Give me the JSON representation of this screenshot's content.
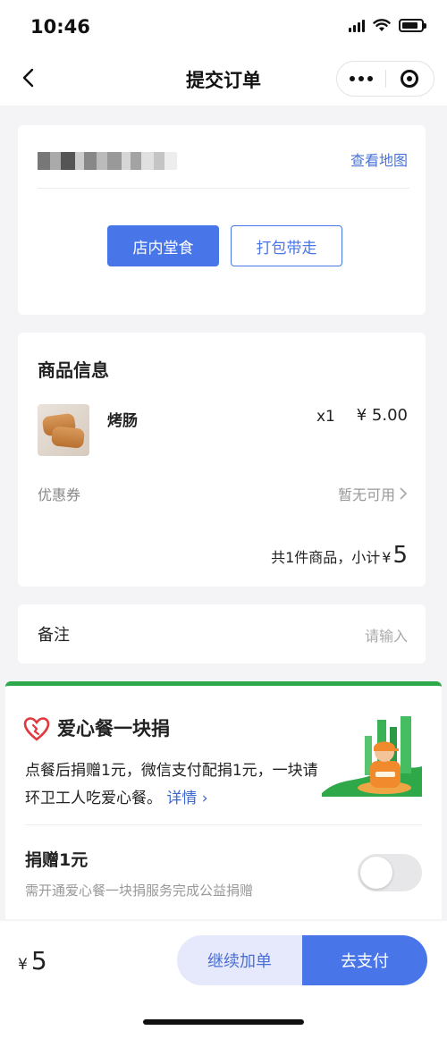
{
  "status_bar": {
    "time": "10:46",
    "battery_level": 0.85
  },
  "nav": {
    "title": "提交订单",
    "back_icon": "chevron-left-icon",
    "more_icon": "more-dots-icon",
    "close_icon": "miniprogram-close-icon"
  },
  "address": {
    "view_map": "查看地图"
  },
  "dining_options": {
    "dine_in": "店内堂食",
    "takeout": "打包带走",
    "selected": "店内堂食"
  },
  "goods": {
    "title": "商品信息",
    "items": [
      {
        "name": "烤肠",
        "qty": "x1",
        "price": "¥ 5.00"
      }
    ],
    "coupon_label": "优惠券",
    "coupon_value": "暂无可用",
    "subtotal_text": "共1件商品，小计",
    "subtotal_yen": "¥",
    "subtotal_amount": "5"
  },
  "remark": {
    "label": "备注",
    "placeholder": "请输入"
  },
  "charity": {
    "title": "爱心餐一块捐",
    "desc": "点餐后捐赠1元，微信支付配捐1元，一块请环卫工人吃爱心餐。",
    "detail": "详情 ›",
    "donate_title": "捐赠1元",
    "donate_sub": "需开通爱心餐一块捐服务完成公益捐赠",
    "donate_enabled": false,
    "accent": "#2da84b"
  },
  "bottom": {
    "total_yen": "¥",
    "total_amount": "5",
    "continue": "继续加单",
    "pay": "去支付"
  },
  "colors": {
    "primary": "#4876e8",
    "link": "#4a74d6"
  }
}
